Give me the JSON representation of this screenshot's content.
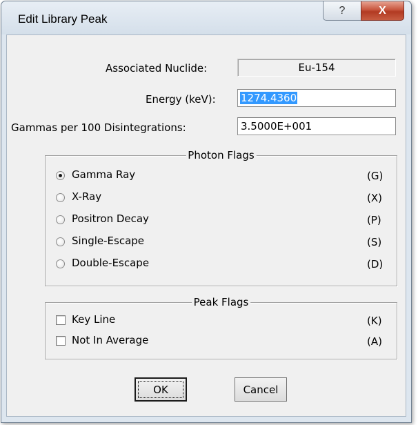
{
  "window": {
    "title": "Edit Library Peak",
    "help_glyph": "?",
    "close_glyph": "X"
  },
  "fields": {
    "nuclide_label": "Associated Nuclide:",
    "nuclide_value": "Eu-154",
    "energy_label": "Energy (keV):",
    "energy_value": "1274.4360",
    "gammas_label": "Gammas per 100 Disintegrations:",
    "gammas_value": "3.5000E+001"
  },
  "photon_flags": {
    "title": "Photon Flags",
    "selected": "Gamma Ray",
    "options": [
      {
        "label": "Gamma Ray",
        "code": "(G)"
      },
      {
        "label": "X-Ray",
        "code": "(X)"
      },
      {
        "label": "Positron Decay",
        "code": "(P)"
      },
      {
        "label": "Single-Escape",
        "code": "(S)"
      },
      {
        "label": "Double-Escape",
        "code": "(D)"
      }
    ]
  },
  "peak_flags": {
    "title": "Peak Flags",
    "options": [
      {
        "label": "Key Line",
        "code": "(K)",
        "checked": false
      },
      {
        "label": "Not In Average",
        "code": "(A)",
        "checked": false
      }
    ]
  },
  "buttons": {
    "ok": "OK",
    "cancel": "Cancel"
  }
}
